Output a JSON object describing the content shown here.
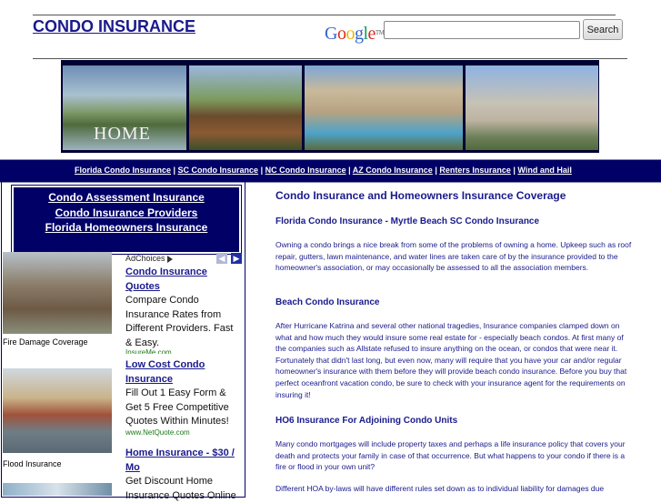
{
  "header": {
    "site_title": "CONDO INSURANCE",
    "google_logo": "Google",
    "google_tm": "TM",
    "search_placeholder": "",
    "search_button": "Search"
  },
  "banner": {
    "home_label": "HOME"
  },
  "nav": {
    "links": [
      "Florida Condo Insurance",
      "SC Condo Insurance",
      "NC Condo Insurance",
      "AZ Condo Insurance",
      "Renters Insurance",
      "Wind and Hail"
    ],
    "separator": " | "
  },
  "sidebar": {
    "box_links": [
      "Condo Assessment Insurance",
      "Condo Insurance Providers",
      "Florida Homeowners Insurance"
    ],
    "thumbs": [
      {
        "caption": "Fire Damage Coverage"
      },
      {
        "caption": "Flood Insurance"
      }
    ],
    "adchoices": "AdChoices",
    "ads": [
      {
        "title": "Condo Insurance Quotes",
        "body": "Compare Condo Insurance Rates from Different Providers. Fast & Easy.",
        "url": "InsureMe.com"
      },
      {
        "title": "Low Cost Condo Insurance",
        "body": "Fill Out 1 Easy Form & Get 5 Free Competitive Quotes Within Minutes!",
        "url": "www.NetQuote.com"
      },
      {
        "title": "Home Insurance - $30 / Mo",
        "body": "Get Discount Home Insurance Quotes Online",
        "url": ""
      }
    ]
  },
  "main": {
    "title": "Condo Insurance and Homeowners Insurance Coverage",
    "sections": [
      {
        "heading": "Florida Condo Insurance - Myrtle Beach SC Condo Insurance",
        "text": "Owning a condo brings a nice break from some of the problems of owning a home.  Upkeep such as roof repair, gutters, lawn maintenance, and water lines are taken care of by the insurance provided to the homeowner's association, or may occasionally be assessed to all the association members."
      },
      {
        "heading": "Beach Condo Insurance",
        "text": "After Hurricane Katrina and several other national tragedies, Insurance companies clamped down on what and how much they would insure some real estate for - especially beach condos. At first many of the companies such as Allstate refused to insure anything on the ocean, or condos that were near it. Fortunately that didn't last long, but even now, many will require that you have your car and/or regular homeowner's insurance with them before they will provide beach condo insurance. Before you buy that perfect oceanfront vacation condo, be sure to check with your insurance agent for the requirements on insuring it!"
      },
      {
        "heading": "HO6 Insurance For Adjoining Condo Units",
        "text": "Many condo mortgages will include property taxes and perhaps a life insurance policy that covers your death and protects your family in case of that occurrence.  But what happens to your condo if there is a fire or flood in your own unit?"
      },
      {
        "heading": "",
        "text": "Different HOA by-laws will have different rules set down as to individual liability for damages due"
      }
    ]
  }
}
